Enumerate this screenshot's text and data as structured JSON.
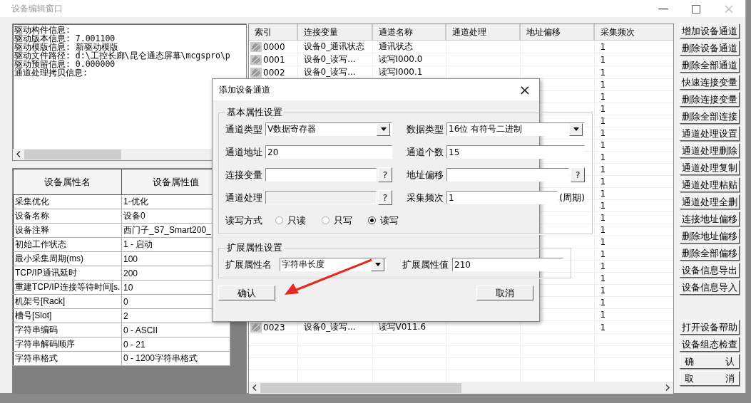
{
  "window": {
    "title": "设备编辑窗口",
    "minimize": "—",
    "maximize": "□",
    "close": "×",
    "close_disabled": true
  },
  "driver_info": [
    "驱动构件信息:",
    "驱动版本信息: 7.001100",
    "驱动模版信息: 新驱动模版",
    "驱动文件路径: d:\\工控长廊\\昆仑通态屏幕\\mcgspro\\p",
    "驱动预留信息: 0.000000",
    "通道处理拷贝信息:"
  ],
  "properties": {
    "columns": [
      "设备属性名",
      "设备属性值"
    ],
    "rows": [
      {
        "name": "采集优化",
        "value": "1-优化"
      },
      {
        "name": "设备名称",
        "value": "设备0"
      },
      {
        "name": "设备注释",
        "value": "西门子_S7_Smart200_"
      },
      {
        "name": "初始工作状态",
        "value": "1 - 启动"
      },
      {
        "name": "最小采集周期(ms)",
        "value": "100"
      },
      {
        "name": "TCP/IP通讯延时",
        "value": "200"
      },
      {
        "name": "重建TCP/IP连接等待时间[s.",
        "value": "10"
      },
      {
        "name": "机架号[Rack]",
        "value": "0"
      },
      {
        "name": "槽号[Slot]",
        "value": "2"
      },
      {
        "name": "字符串编码",
        "value": "0 - ASCII"
      },
      {
        "name": "字符串解码顺序",
        "value": "0 - 21"
      },
      {
        "name": "字符串格式",
        "value": "0 - 1200字符串格式"
      }
    ]
  },
  "channels": {
    "columns": [
      "索引",
      "连接变量",
      "通道名称",
      "通道处理",
      "地址偏移",
      "采集频次"
    ],
    "rows": [
      {
        "index": "0000",
        "variable": "设备0_通讯状态",
        "name": "通讯状态",
        "frequency": "1"
      },
      {
        "index": "0001",
        "variable": "设备0_读写...",
        "name": "读写I000.0",
        "frequency": "1"
      },
      {
        "index": "0002",
        "variable": "设备0_读写...",
        "name": "读写I000.1",
        "frequency": "1"
      },
      {
        "frequency": "1"
      },
      {
        "frequency": "1"
      },
      {
        "frequency": "1"
      },
      {
        "frequency": "1"
      },
      {
        "frequency": "1"
      },
      {
        "frequency": "1"
      },
      {
        "frequency": "1"
      },
      {
        "frequency": "1"
      },
      {
        "frequency": "1"
      },
      {
        "frequency": "1"
      },
      {
        "frequency": "1"
      },
      {
        "frequency": "1"
      },
      {
        "frequency": "1"
      },
      {
        "frequency": "1"
      },
      {
        "frequency": "1"
      },
      {
        "frequency": "1"
      },
      {
        "frequency": "1"
      },
      {
        "frequency": "1"
      },
      {
        "frequency": "1"
      },
      {
        "frequency": "1"
      },
      {
        "index": "0023",
        "variable": "设备0_读写...",
        "name": "读写V011.6",
        "frequency": "1"
      }
    ]
  },
  "side_buttons": [
    "增加设备通道",
    "删除设备通道",
    "删除全部通道",
    "快速连接变量",
    "删除连接变量",
    "删除全部连接",
    "通道处理设置",
    "通道处理删除",
    "通道处理复制",
    "通道处理粘贴",
    "通道处理全删",
    "连接地址偏移",
    "删除地址偏移",
    "删除全部偏移",
    "设备信息导出",
    "设备信息导入"
  ],
  "bottom_buttons": [
    "打开设备帮助",
    "设备组态检查",
    "确 认",
    "取 消"
  ],
  "dialog": {
    "title": "添加设备通道",
    "close": "×",
    "basic_group": "基本属性设置",
    "fields": [
      {
        "kind": "dropdown",
        "label": "通道类型",
        "value": "V数据寄存器"
      },
      {
        "kind": "dropdown",
        "label": "数据类型",
        "value": "16位 有符号二进制"
      },
      {
        "kind": "text",
        "label": "通道地址",
        "value": "20"
      },
      {
        "kind": "text",
        "label": "通道个数",
        "value": "15"
      },
      {
        "kind": "browse",
        "label": "连接变量",
        "button": "?"
      },
      {
        "kind": "browse",
        "label": "地址偏移",
        "button": "?"
      },
      {
        "kind": "browse",
        "label": "通道处理",
        "button": "?",
        "disabled": true
      },
      {
        "kind": "text",
        "label": "采集频次",
        "value": "1",
        "suffix": "(周期)"
      }
    ],
    "rw_label": "读写方式",
    "rw_options": [
      {
        "label": "只读",
        "selected": false
      },
      {
        "label": "只写",
        "selected": false
      },
      {
        "label": "读写",
        "selected": true
      }
    ],
    "ext_group": "扩展属性设置",
    "ext_name_label": "扩展属性名",
    "ext_name_value": "字符串长度",
    "ext_value_label": "扩展属性值",
    "ext_value": "210",
    "ok": "确认",
    "cancel": "取消"
  }
}
